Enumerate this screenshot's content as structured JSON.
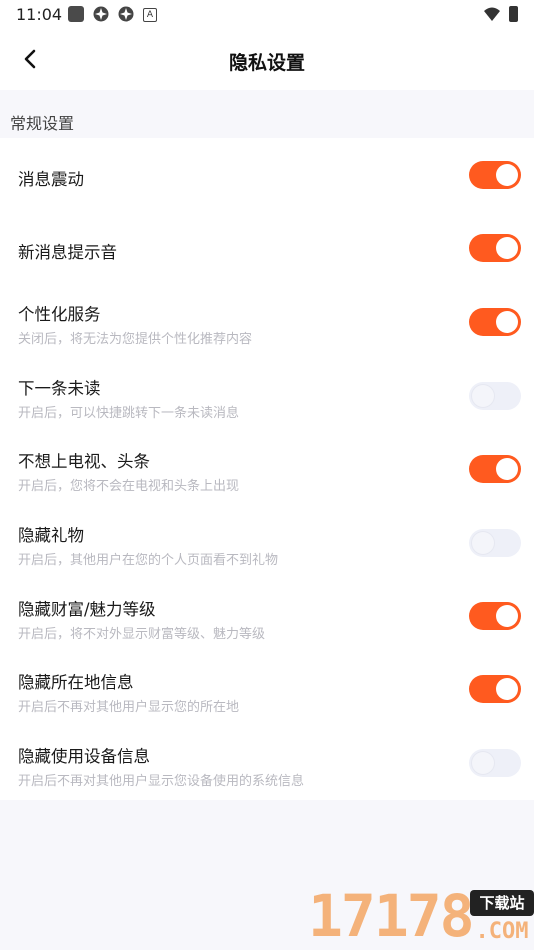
{
  "status_bar": {
    "time": "11:04",
    "badge_letter": "A"
  },
  "header": {
    "title": "隐私设置"
  },
  "section": {
    "label": "常规设置"
  },
  "settings": [
    {
      "title": "消息震动",
      "desc": "",
      "on": true
    },
    {
      "title": "新消息提示音",
      "desc": "",
      "on": true
    },
    {
      "title": "个性化服务",
      "desc": "关闭后，将无法为您提供个性化推荐内容",
      "on": true
    },
    {
      "title": "下一条未读",
      "desc": "开启后，可以快捷跳转下一条未读消息",
      "on": false
    },
    {
      "title": "不想上电视、头条",
      "desc": "开启后，您将不会在电视和头条上出现",
      "on": true
    },
    {
      "title": "隐藏礼物",
      "desc": "开启后，其他用户在您的个人页面看不到礼物",
      "on": false
    },
    {
      "title": "隐藏财富/魅力等级",
      "desc": "开启后，将不对外显示财富等级、魅力等级",
      "on": true
    },
    {
      "title": "隐藏所在地信息",
      "desc": "开启后不再对其他用户显示您的所在地",
      "on": true
    },
    {
      "title": "隐藏使用设备信息",
      "desc": "开启后不再对其他用户显示您设备使用的系统信息",
      "on": false
    }
  ],
  "watermark": {
    "number": "17178",
    "badge": "下载站",
    "suffix": ".COM"
  },
  "colors": {
    "accent": "#ff5a1f",
    "toggle_off": "#eef0f8",
    "background": "#f7f7fb"
  },
  "icons": {
    "back": "chevron-left-icon",
    "wifi": "wifi-icon",
    "battery": "battery-icon"
  }
}
